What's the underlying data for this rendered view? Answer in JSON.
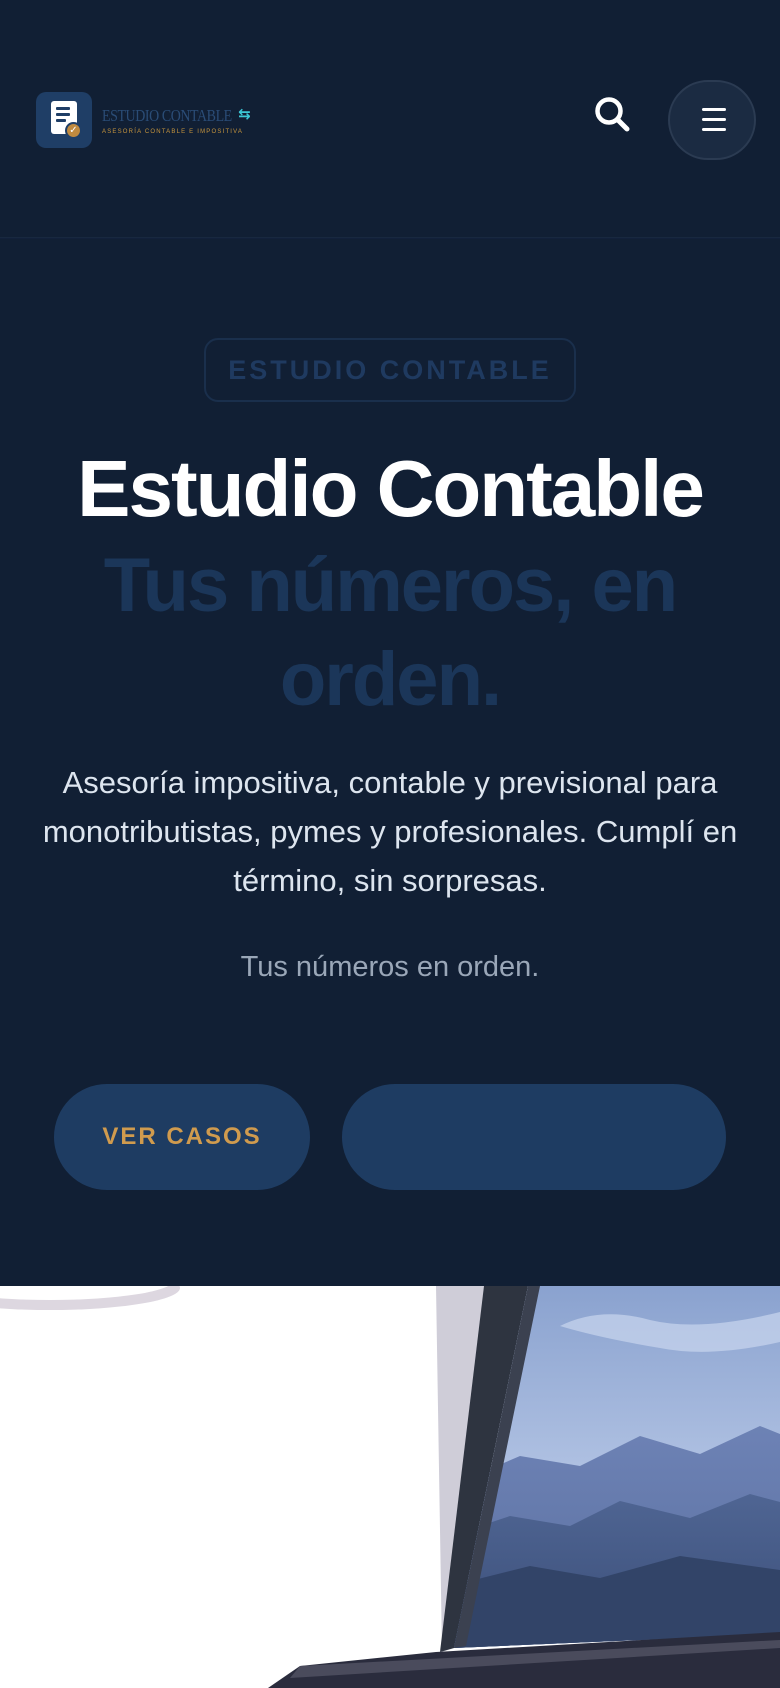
{
  "header": {
    "logo": {
      "name": "ESTUDIO CONTABLE",
      "tagline": "ASESORÍA CONTABLE E IMPOSITIVA",
      "icon": "document-check-icon"
    },
    "search_icon": "search-icon",
    "menu_icon": "hamburger-menu-icon"
  },
  "hero": {
    "eyebrow": "ESTUDIO CONTABLE",
    "title": "Estudio Contable",
    "subtitle": "Tus números, en orden.",
    "description": "Asesoría impositiva, contable y previsional para monotributistas, pymes y profesionales. Cumplí en término, sin sorpresas.",
    "tagline": "Tus números en orden.",
    "buttons": {
      "primary_label": "VER CASOS",
      "secondary_label": ""
    }
  },
  "image": {
    "subject": "laptop-with-mountain-landscape-photo"
  },
  "colors": {
    "background": "#111f34",
    "accent_navy": "#1e3c62",
    "accent_gold": "#d09b4e",
    "accent_teal": "#3cc8d6"
  }
}
